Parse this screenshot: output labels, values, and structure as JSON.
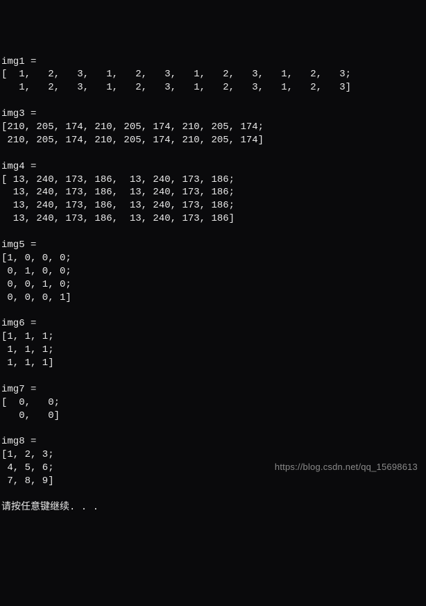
{
  "lines": [
    "img1 =",
    "[  1,   2,   3,   1,   2,   3,   1,   2,   3,   1,   2,   3;",
    "   1,   2,   3,   1,   2,   3,   1,   2,   3,   1,   2,   3]",
    "",
    "img3 =",
    "[210, 205, 174, 210, 205, 174, 210, 205, 174;",
    " 210, 205, 174, 210, 205, 174, 210, 205, 174]",
    "",
    "img4 =",
    "[ 13, 240, 173, 186,  13, 240, 173, 186;",
    "  13, 240, 173, 186,  13, 240, 173, 186;",
    "  13, 240, 173, 186,  13, 240, 173, 186;",
    "  13, 240, 173, 186,  13, 240, 173, 186]",
    "",
    "img5 =",
    "[1, 0, 0, 0;",
    " 0, 1, 0, 0;",
    " 0, 0, 1, 0;",
    " 0, 0, 0, 1]",
    "",
    "img6 =",
    "[1, 1, 1;",
    " 1, 1, 1;",
    " 1, 1, 1]",
    "",
    "img7 =",
    "[  0,   0;",
    "   0,   0]",
    "",
    "img8 =",
    "[1, 2, 3;",
    " 4, 5, 6;",
    " 7, 8, 9]",
    "",
    "请按任意键继续. . ."
  ],
  "watermark": "https://blog.csdn.net/qq_15698613",
  "chart_data": {
    "type": "table",
    "matrices": [
      {
        "name": "img1",
        "rows": 2,
        "cols": 12,
        "data": [
          [
            1,
            2,
            3,
            1,
            2,
            3,
            1,
            2,
            3,
            1,
            2,
            3
          ],
          [
            1,
            2,
            3,
            1,
            2,
            3,
            1,
            2,
            3,
            1,
            2,
            3
          ]
        ]
      },
      {
        "name": "img3",
        "rows": 2,
        "cols": 9,
        "data": [
          [
            210,
            205,
            174,
            210,
            205,
            174,
            210,
            205,
            174
          ],
          [
            210,
            205,
            174,
            210,
            205,
            174,
            210,
            205,
            174
          ]
        ]
      },
      {
        "name": "img4",
        "rows": 4,
        "cols": 8,
        "data": [
          [
            13,
            240,
            173,
            186,
            13,
            240,
            173,
            186
          ],
          [
            13,
            240,
            173,
            186,
            13,
            240,
            173,
            186
          ],
          [
            13,
            240,
            173,
            186,
            13,
            240,
            173,
            186
          ],
          [
            13,
            240,
            173,
            186,
            13,
            240,
            173,
            186
          ]
        ]
      },
      {
        "name": "img5",
        "rows": 4,
        "cols": 4,
        "data": [
          [
            1,
            0,
            0,
            0
          ],
          [
            0,
            1,
            0,
            0
          ],
          [
            0,
            0,
            1,
            0
          ],
          [
            0,
            0,
            0,
            1
          ]
        ]
      },
      {
        "name": "img6",
        "rows": 3,
        "cols": 3,
        "data": [
          [
            1,
            1,
            1
          ],
          [
            1,
            1,
            1
          ],
          [
            1,
            1,
            1
          ]
        ]
      },
      {
        "name": "img7",
        "rows": 2,
        "cols": 2,
        "data": [
          [
            0,
            0
          ],
          [
            0,
            0
          ]
        ]
      },
      {
        "name": "img8",
        "rows": 3,
        "cols": 3,
        "data": [
          [
            1,
            2,
            3
          ],
          [
            4,
            5,
            6
          ],
          [
            7,
            8,
            9
          ]
        ]
      }
    ]
  }
}
